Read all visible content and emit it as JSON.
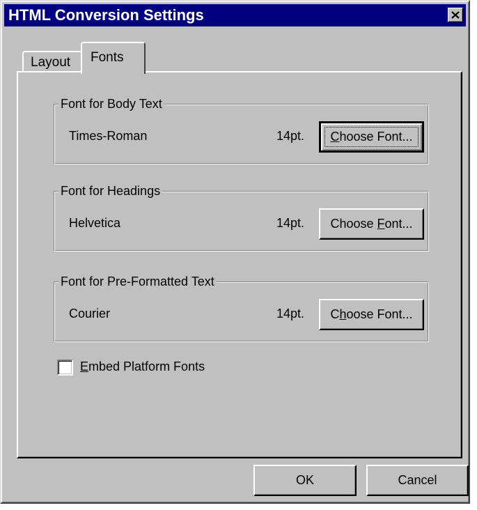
{
  "window": {
    "title": "HTML Conversion Settings",
    "close_icon": "close-icon"
  },
  "tabs": [
    {
      "label": "Layout",
      "selected": false
    },
    {
      "label": "Fonts",
      "selected": true
    }
  ],
  "groups": {
    "body": {
      "legend": "Font for Body Text",
      "font_name": "Times-Roman",
      "font_size": "14pt.",
      "button_label": "Choose Font...",
      "mnemonic": "C"
    },
    "headings": {
      "legend": "Font for Headings",
      "font_name": "Helvetica",
      "font_size": "14pt.",
      "button_label": "Choose Font...",
      "mnemonic": "F"
    },
    "preformatted": {
      "legend": "Font for Pre-Formatted Text",
      "font_name": "Courier",
      "font_size": "14pt.",
      "button_label": "Choose Font...",
      "mnemonic": "h"
    }
  },
  "embed_fonts": {
    "label": "Embed Platform Fonts",
    "mnemonic": "E",
    "checked": false
  },
  "footer": {
    "ok_label": "OK",
    "cancel_label": "Cancel"
  },
  "colors": {
    "titlebar": "#000080",
    "face": "#c0c0c0"
  }
}
